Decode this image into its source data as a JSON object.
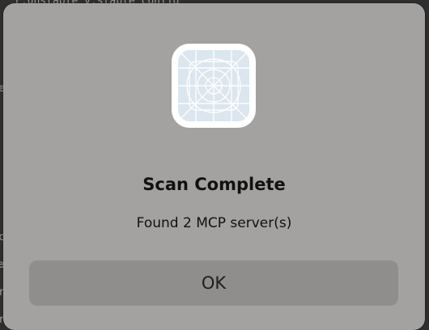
{
  "dialog": {
    "icon": "app-placeholder-icon",
    "title": "Scan Complete",
    "message": "Found 2 MCP server(s)",
    "ok_label": "OK"
  },
  "colors": {
    "dialog_background": "#a3a2a1",
    "button_background": "#8f8e8d",
    "icon_tile": "#dbe6ee",
    "text": "#111111"
  }
}
